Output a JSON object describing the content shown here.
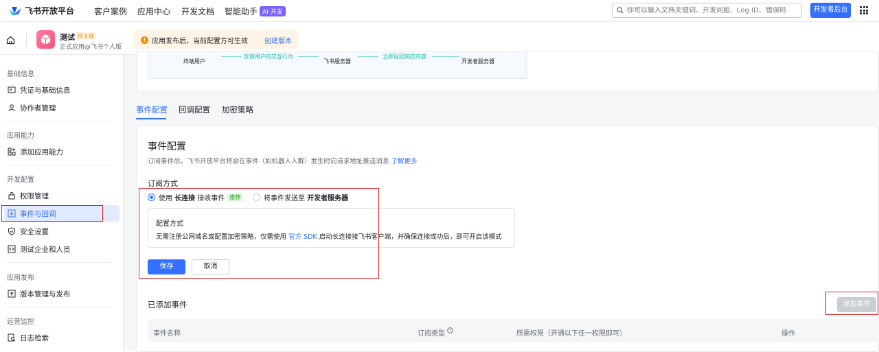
{
  "topbar": {
    "logo": "飞书开放平台",
    "nav": [
      "客户案例",
      "应用中心",
      "开发文档",
      "智能助手"
    ],
    "ai_badge": "AI 开发",
    "search_placeholder": "你可以输入文档关键词、开发问题、Log ID、错误码",
    "dev_console": "开发者后台"
  },
  "app": {
    "name": "测试",
    "status": "待上线",
    "subtitle": "正式应用@飞书个人版",
    "notice": "应用发布后，当前配置方可生效",
    "notice_link": "创建版本"
  },
  "sidebar": {
    "sections": [
      {
        "title": "基础信息",
        "items": [
          "凭证与基础信息",
          "协作者管理"
        ]
      },
      {
        "title": "应用能力",
        "items": [
          "添加应用能力"
        ]
      },
      {
        "title": "开发配置",
        "items": [
          "权限管理",
          "事件与回调",
          "安全设置",
          "测试企业和人员"
        ]
      },
      {
        "title": "应用发布",
        "items": [
          "版本管理与发布"
        ]
      },
      {
        "title": "运营监控",
        "items": [
          "日志检索"
        ]
      }
    ],
    "active": "事件与回调"
  },
  "diagram": {
    "end_user": "终端用户",
    "feedback": "反馈用户的交互行为",
    "feishu_server": "飞书服务器",
    "instant_return": "立即返回响应内容",
    "dev_server": "开发者服务器"
  },
  "tabs": [
    "事件配置",
    "回调配置",
    "加密策略"
  ],
  "event_config": {
    "title": "事件配置",
    "desc": "订阅事件后，飞书开放平台将会在事件（如机器人入群）发生时向请求地址推送消息",
    "learn_more": "了解更多",
    "sub_title": "订阅方式",
    "option1_pre": "使用",
    "option1_bold": "长连接",
    "option1_post": "接收事件",
    "option1_tag": "推荐",
    "option2_pre": "将事件发送至",
    "option2_bold": "开发者服务器",
    "config_title": "配置方式",
    "config_desc_pre": "无需注册公网域名或配置加密策略，仅需使用",
    "config_link": "官方 SDK",
    "config_desc_post": "启动长连接接飞书客户端，并确保连接成功后，即可开启该模式",
    "save": "保存",
    "cancel": "取消",
    "added_title": "已添加事件",
    "add_event": "添加事件",
    "columns": [
      "事件名称",
      "订阅类型",
      "所需权限（开通以下任一权限即可）",
      "操作"
    ]
  },
  "colors": {
    "accent": "#3370ff",
    "highlight": "#e02020"
  }
}
